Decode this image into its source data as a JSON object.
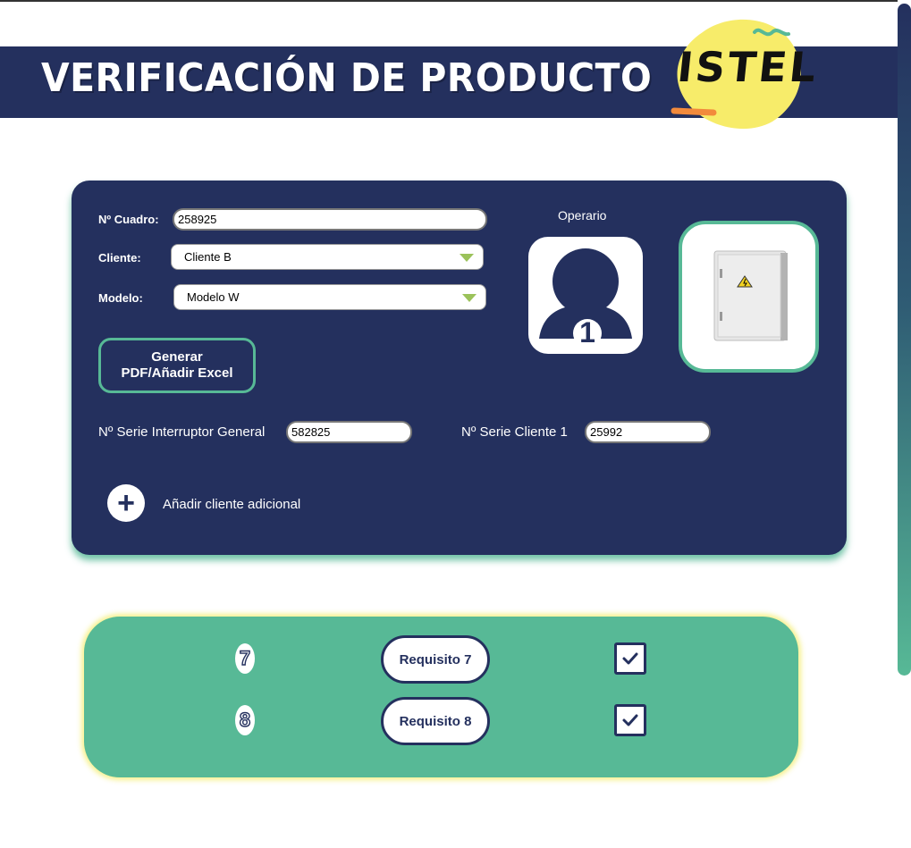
{
  "header": {
    "title": "VERIFICACIÓN DE PRODUCTO",
    "logo_text": "ISTEL",
    "brand_color": "#24305e",
    "accent_color": "#57b996",
    "logo_color": "#f7ec6a"
  },
  "form": {
    "cuadro_label": "Nº Cuadro:",
    "cuadro_value": "258925",
    "cliente_label": "Cliente:",
    "cliente_selected": "Cliente B",
    "modelo_label": "Modelo:",
    "modelo_selected": "Modelo W",
    "generate_button": "Generar\nPDF/Añadir Excel",
    "serie_interruptor_label": "Nº Serie Interruptor General",
    "serie_interruptor_value": "582825",
    "serie_cliente_label": "Nº Serie Cliente 1",
    "serie_cliente_value": "25992",
    "add_client_label": "Añadir cliente adicional",
    "add_client_icon": "+"
  },
  "operator": {
    "title": "Operario",
    "number": "1",
    "icon": "user-avatar-icon"
  },
  "product": {
    "icon": "electrical-cabinet-image"
  },
  "requirements": [
    {
      "number": "7",
      "label": "Requisito 7",
      "checked": true
    },
    {
      "number": "8",
      "label": "Requisito 8",
      "checked": true
    }
  ]
}
